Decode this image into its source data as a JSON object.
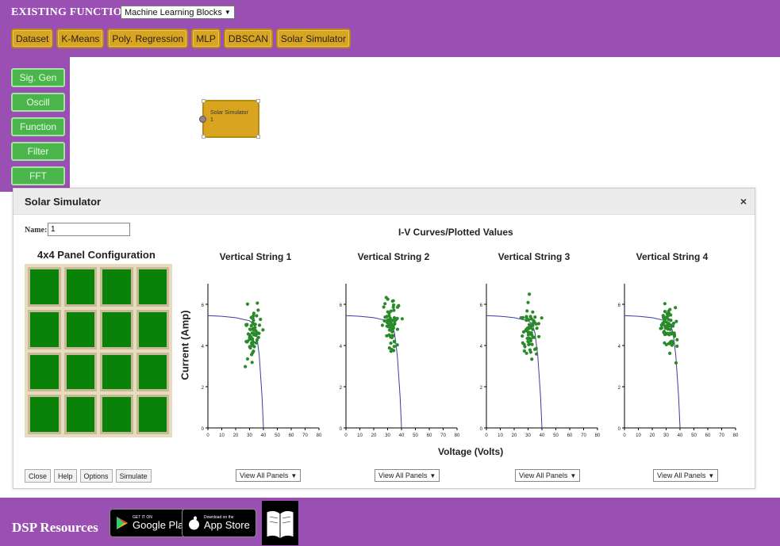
{
  "header": {
    "title": "EXISTING FUNCTIONS",
    "dropdown_value": "Machine Learning Blocks",
    "tabs": [
      "Dataset",
      "K-Means",
      "Poly. Regression",
      "MLP",
      "DBSCAN",
      "Solar Simulator"
    ]
  },
  "sidebar": {
    "buttons": [
      "Sig. Gen",
      "Oscill",
      "Function",
      "Filter",
      "FFT"
    ]
  },
  "canvas": {
    "block_label": "Solar Simulator",
    "block_id": "1"
  },
  "dialog": {
    "title": "Solar Simulator",
    "close_glyph": "×",
    "name_label": "Name:",
    "name_value": "1",
    "panel_title": "4x4 Panel Configuration",
    "panel_rows": 4,
    "panel_cols": 4,
    "buttons": [
      "Close",
      "Help",
      "Options",
      "Simulate"
    ],
    "iv_title": "I-V Curves/Plotted Values",
    "ylabel": "Current (Amp)",
    "xlabel": "Voltage (Volts)",
    "view_select_label": "View All Panels"
  },
  "chart_data": [
    {
      "type": "scatter",
      "title": "Vertical String 1",
      "xlim": [
        0,
        80
      ],
      "ylim": [
        0,
        7
      ],
      "xticks": [
        0,
        10,
        20,
        30,
        40,
        50,
        60,
        70,
        80
      ],
      "yticks": [
        0,
        2,
        4,
        6
      ],
      "curve": {
        "x": [
          0,
          10,
          20,
          30,
          33,
          35,
          37,
          39,
          40
        ],
        "y": [
          5.45,
          5.42,
          5.35,
          5.2,
          5.05,
          4.6,
          3.5,
          1.5,
          0
        ]
      },
      "scatter_center": [
        32,
        4.6
      ],
      "scatter_spread": [
        5,
        1.0
      ],
      "point_count": 65
    },
    {
      "type": "scatter",
      "title": "Vertical String 2",
      "xlim": [
        0,
        80
      ],
      "ylim": [
        0,
        7
      ],
      "xticks": [
        0,
        10,
        20,
        30,
        40,
        50,
        60,
        70,
        80
      ],
      "yticks": [
        0,
        2,
        4,
        6
      ],
      "curve": {
        "x": [
          0,
          10,
          20,
          30,
          33,
          35,
          37,
          39,
          40
        ],
        "y": [
          5.45,
          5.42,
          5.35,
          5.2,
          5.05,
          4.6,
          3.5,
          1.5,
          0
        ]
      },
      "scatter_center": [
        33,
        5.0
      ],
      "scatter_spread": [
        5,
        1.0
      ],
      "point_count": 65
    },
    {
      "type": "scatter",
      "title": "Vertical String 3",
      "xlim": [
        0,
        80
      ],
      "ylim": [
        0,
        7
      ],
      "xticks": [
        0,
        10,
        20,
        30,
        40,
        50,
        60,
        70,
        80
      ],
      "yticks": [
        0,
        2,
        4,
        6
      ],
      "curve": {
        "x": [
          0,
          10,
          20,
          30,
          33,
          35,
          37,
          39,
          40
        ],
        "y": [
          5.45,
          5.42,
          5.35,
          5.2,
          5.05,
          4.6,
          3.5,
          1.5,
          0
        ]
      },
      "scatter_center": [
        31,
        4.7
      ],
      "scatter_spread": [
        5,
        1.0
      ],
      "point_count": 65
    },
    {
      "type": "scatter",
      "title": "Vertical String 4",
      "xlim": [
        0,
        80
      ],
      "ylim": [
        0,
        7
      ],
      "xticks": [
        0,
        10,
        20,
        30,
        40,
        50,
        60,
        70,
        80
      ],
      "yticks": [
        0,
        2,
        4,
        6
      ],
      "curve": {
        "x": [
          0,
          10,
          20,
          30,
          33,
          35,
          37,
          39,
          40
        ],
        "y": [
          5.45,
          5.42,
          5.35,
          5.2,
          5.05,
          4.6,
          3.5,
          1.5,
          0
        ]
      },
      "scatter_center": [
        32,
        4.9
      ],
      "scatter_spread": [
        5,
        1.0
      ],
      "point_count": 65
    }
  ],
  "footer": {
    "title": "DSP Resources",
    "google_small": "GET IT ON",
    "google_big": "Google Play",
    "apple_small": "Download on the",
    "apple_big": "App Store"
  },
  "colors": {
    "purple": "#9a4fb2",
    "tab_gold": "#d9a520",
    "side_green": "#4ab54a",
    "panel_green": "#0a820a",
    "scatter_green": "#2a8a2a",
    "curve_blue": "#3a3aa8"
  }
}
